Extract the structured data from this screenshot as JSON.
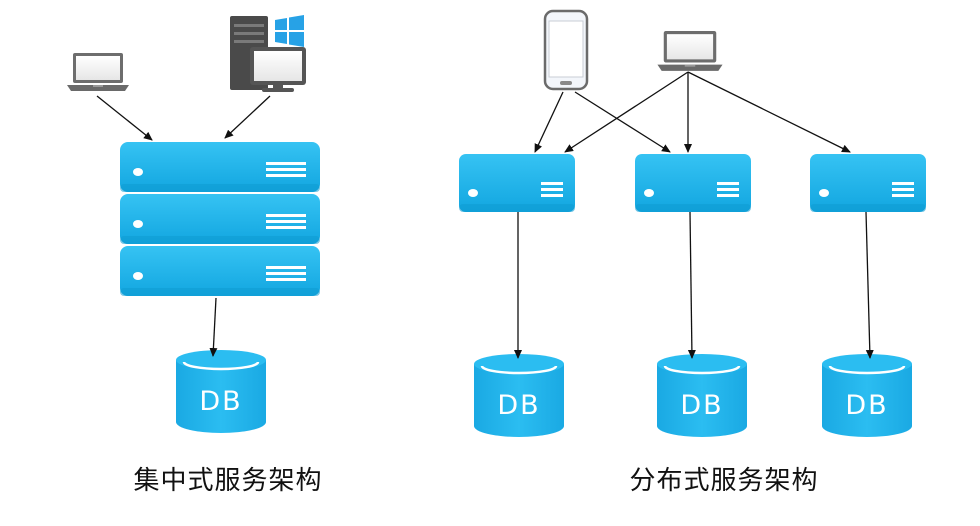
{
  "captions": {
    "centralized": "集中式服务架构",
    "distributed": "分布式服务架构"
  },
  "db_label": "DB",
  "colors": {
    "server": "#1fb2ea",
    "server_dark": "#0e9bd2",
    "db": "#1eb0e8",
    "device": "#6a6a6a",
    "arrow": "#111111"
  },
  "icons": [
    "laptop-icon",
    "desktop-pc-icon",
    "windows-logo-icon",
    "smartphone-icon",
    "server-icon",
    "database-icon"
  ]
}
